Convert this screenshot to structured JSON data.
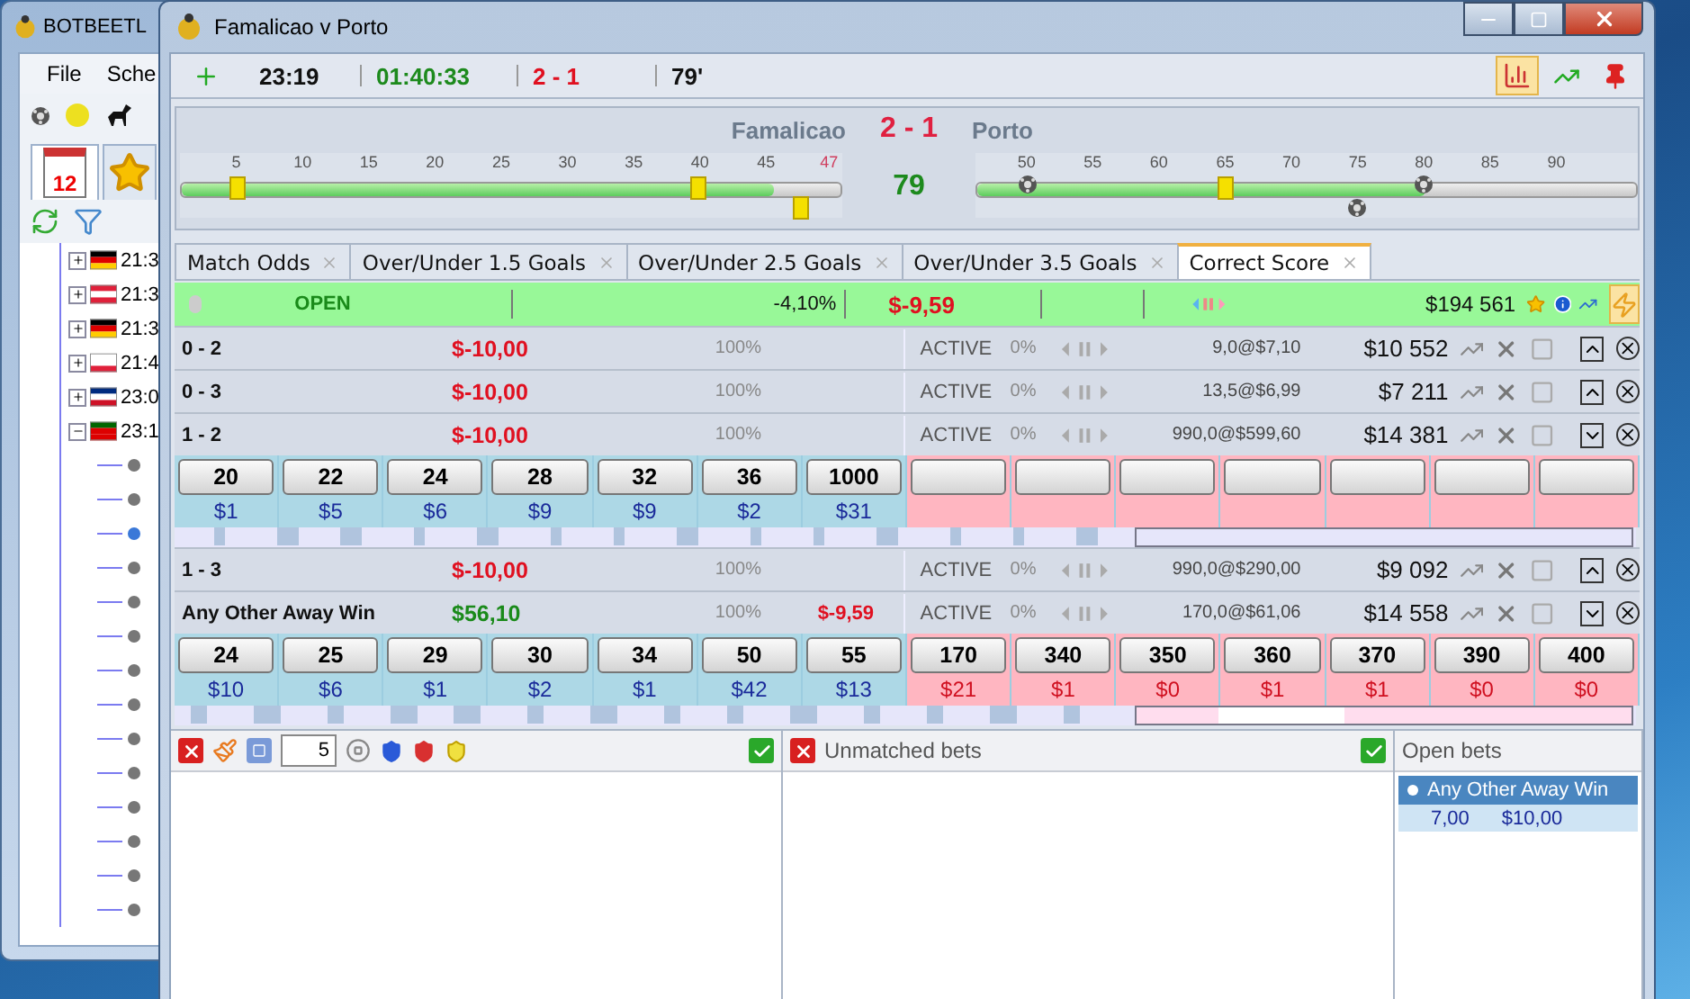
{
  "back_window": {
    "title": "BOTBEETL",
    "menu": [
      "File",
      "Sche"
    ],
    "tabs": [
      {
        "kind": "calendar",
        "label": "12",
        "selected": true
      },
      {
        "kind": "star",
        "selected": false
      }
    ],
    "tree": [
      {
        "kind": "de",
        "time": "21:3",
        "expanded": false
      },
      {
        "kind": "at",
        "time": "21:3",
        "expanded": false
      },
      {
        "kind": "de",
        "time": "21:3",
        "expanded": false
      },
      {
        "kind": "pl",
        "time": "21:4",
        "expanded": false
      },
      {
        "kind": "cr",
        "time": "23:0",
        "expanded": false
      },
      {
        "kind": "pt",
        "time": "23:1",
        "expanded": true,
        "children": [
          {
            "selected": false
          },
          {
            "selected": false
          },
          {
            "selected": true
          },
          {
            "selected": false
          },
          {
            "selected": false
          },
          {
            "selected": false
          },
          {
            "selected": false
          },
          {
            "selected": false
          },
          {
            "selected": false
          },
          {
            "selected": false
          },
          {
            "selected": false
          },
          {
            "selected": false
          },
          {
            "selected": false
          },
          {
            "selected": false
          }
        ]
      }
    ]
  },
  "window": {
    "title": "Famalicao v Porto"
  },
  "toolbar": {
    "time": "23:19",
    "elapsed": "01:40:33",
    "score": "2 - 1",
    "minute": "79'",
    "chart_view_on": true
  },
  "scoreboard": {
    "home": "Famalicao",
    "score": "2 - 1",
    "away": "Porto",
    "minute": "79",
    "halves": [
      {
        "level": 0.9,
        "ticks": [
          {
            "label": "5",
            "kind": "card",
            "below": false
          },
          {
            "label": "10",
            "kind": "plain"
          },
          {
            "label": "15",
            "kind": "plain"
          },
          {
            "label": "20",
            "kind": "plain"
          },
          {
            "label": "25",
            "kind": "plain"
          },
          {
            "label": "30",
            "kind": "plain"
          },
          {
            "label": "35",
            "kind": "plain"
          },
          {
            "label": "40",
            "kind": "card",
            "below": false
          },
          {
            "label": "45",
            "kind": "plain"
          }
        ],
        "stoppage_tick": {
          "label": "47",
          "kind": "card",
          "below": true
        }
      },
      {
        "level": 0.68,
        "ticks": [
          {
            "label": "50",
            "kind": "goal",
            "below": false
          },
          {
            "label": "55",
            "kind": "plain"
          },
          {
            "label": "60",
            "kind": "plain"
          },
          {
            "label": "65",
            "kind": "card",
            "below": false
          },
          {
            "label": "70",
            "kind": "plain"
          },
          {
            "label": "75",
            "kind": "goal",
            "below": true
          },
          {
            "label": "80",
            "kind": "goal",
            "below": false
          },
          {
            "label": "85",
            "kind": "plain"
          },
          {
            "label": "90",
            "kind": "plain"
          }
        ]
      }
    ]
  },
  "tabs": [
    {
      "label": "Match Odds",
      "selected": false
    },
    {
      "label": "Over/Under 1.5 Goals",
      "selected": false
    },
    {
      "label": "Over/Under 2.5 Goals",
      "selected": false
    },
    {
      "label": "Over/Under 3.5 Goals",
      "selected": false
    },
    {
      "label": "Correct Score",
      "selected": true
    }
  ],
  "market": {
    "status": "OPEN",
    "percent": "-4,10%",
    "pl": "$-9,59",
    "matched": "$194 561",
    "auto_on": true
  },
  "rows": [
    {
      "name": "0 - 2",
      "pl": "$-10,00",
      "profit": false,
      "percent": "100%",
      "status": "ACTIVE",
      "status_percent": "0%",
      "bet": "9,0@$7,10",
      "volume": "$10 552",
      "expanded": false
    },
    {
      "name": "0 - 3",
      "pl": "$-10,00",
      "profit": false,
      "percent": "100%",
      "status": "ACTIVE",
      "status_percent": "0%",
      "bet": "13,5@$6,99",
      "volume": "$7 211",
      "expanded": false
    },
    {
      "name": "1 - 2",
      "pl": "$-10,00",
      "profit": false,
      "percent": "100%",
      "status": "ACTIVE",
      "status_percent": "0%",
      "bet": "990,0@$599,60",
      "volume": "$14 381",
      "expanded": true,
      "ladder": [
        {
          "kind": "back",
          "price": "20",
          "amount": "$1"
        },
        {
          "kind": "back",
          "price": "22",
          "amount": "$5"
        },
        {
          "kind": "back",
          "price": "24",
          "amount": "$6"
        },
        {
          "kind": "back",
          "price": "28",
          "amount": "$9"
        },
        {
          "kind": "back",
          "price": "32",
          "amount": "$9"
        },
        {
          "kind": "back",
          "price": "36",
          "amount": "$2"
        },
        {
          "kind": "back",
          "price": "1000",
          "amount": "$31"
        },
        {
          "kind": "empty"
        },
        {
          "kind": "empty"
        },
        {
          "kind": "empty"
        },
        {
          "kind": "empty"
        },
        {
          "kind": "empty"
        },
        {
          "kind": "empty"
        },
        {
          "kind": "empty"
        }
      ]
    },
    {
      "name": "1 - 3",
      "pl": "$-10,00",
      "profit": false,
      "percent": "100%",
      "status": "ACTIVE",
      "status_percent": "0%",
      "bet": "990,0@$290,00",
      "volume": "$9 092",
      "expanded": false
    },
    {
      "name": "Any Other Away Win",
      "pl": "$56,10",
      "profit": true,
      "percent": "100%",
      "hedge": "$-9,59",
      "status": "ACTIVE",
      "status_percent": "0%",
      "bet": "170,0@$61,06",
      "volume": "$14 558",
      "expanded": true,
      "ladder": [
        {
          "kind": "back",
          "price": "24",
          "amount": "$10"
        },
        {
          "kind": "back",
          "price": "25",
          "amount": "$6"
        },
        {
          "kind": "back",
          "price": "29",
          "amount": "$1"
        },
        {
          "kind": "back",
          "price": "30",
          "amount": "$2"
        },
        {
          "kind": "back",
          "price": "34",
          "amount": "$1"
        },
        {
          "kind": "back",
          "price": "50",
          "amount": "$42"
        },
        {
          "kind": "back",
          "price": "55",
          "amount": "$13"
        },
        {
          "kind": "lay",
          "price": "170",
          "amount": "$21"
        },
        {
          "kind": "lay",
          "price": "340",
          "amount": "$1"
        },
        {
          "kind": "lay",
          "price": "350",
          "amount": "$0"
        },
        {
          "kind": "lay",
          "price": "360",
          "amount": "$1"
        },
        {
          "kind": "lay",
          "price": "370",
          "amount": "$1"
        },
        {
          "kind": "lay",
          "price": "390",
          "amount": "$0"
        },
        {
          "kind": "lay",
          "price": "400",
          "amount": "$0"
        }
      ]
    }
  ],
  "bet_panel": {
    "stake": "5"
  },
  "unmatched": {
    "title": "Unmatched bets"
  },
  "open_bets": {
    "title": "Open bets",
    "bets": [
      {
        "selection": "Any Other Away Win",
        "odds": "7,00",
        "stake": "$10,00",
        "selected": true
      }
    ]
  }
}
